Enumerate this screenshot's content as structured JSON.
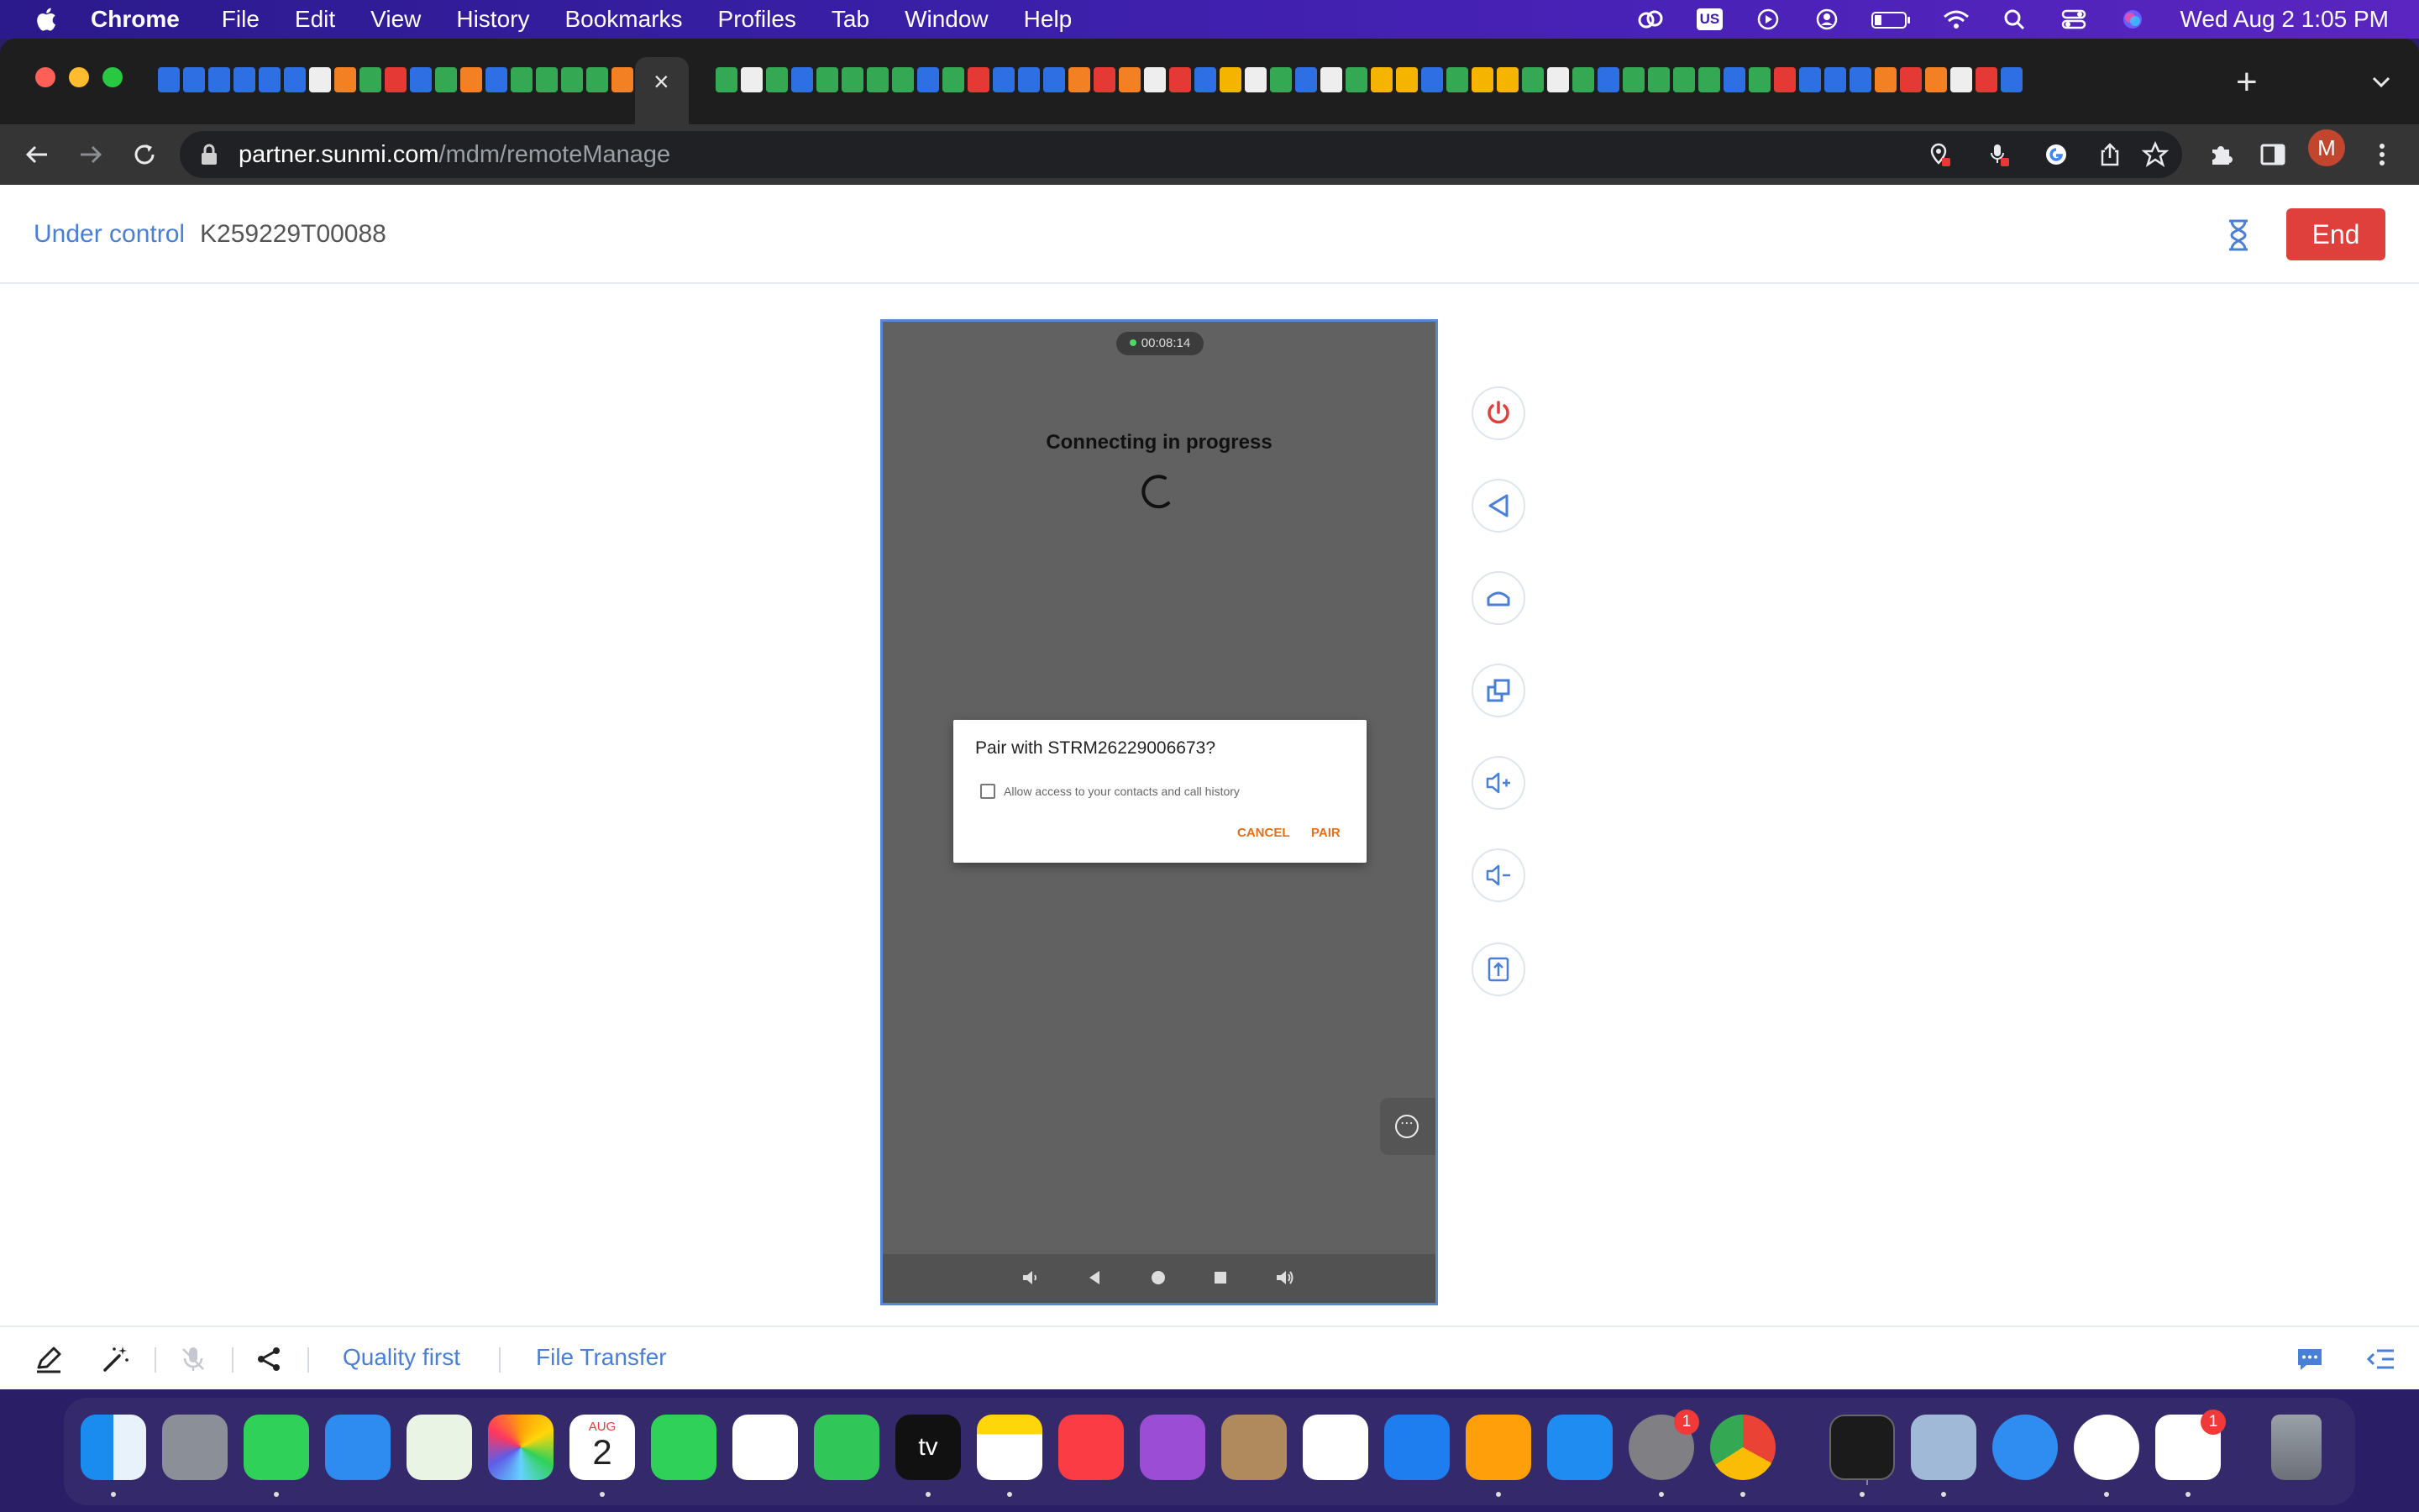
{
  "menubar": {
    "app_name": "Chrome",
    "items": [
      "File",
      "Edit",
      "View",
      "History",
      "Bookmarks",
      "Profiles",
      "Tab",
      "Window",
      "Help"
    ],
    "input_source": "US",
    "clock": "Wed Aug 2  1:05 PM"
  },
  "browser": {
    "url_host": "partner.sunmi.com",
    "url_path": "/mdm/remoteManage",
    "profile_initial": "M",
    "tab_close": "×",
    "new_tab": "+"
  },
  "header": {
    "status_label": "Under control",
    "device_id": "K259229T00088",
    "end_label": "End"
  },
  "device": {
    "session_timer": "00:08:14",
    "status_text": "Connecting in progress",
    "dialog": {
      "title": "Pair with STRM26229006673?",
      "checkbox_label": "Allow access to your contacts and call history",
      "cancel_label": "CANCEL",
      "pair_label": "PAIR"
    },
    "more_glyph": "⋯"
  },
  "bottom_toolbar": {
    "quality_label": "Quality first",
    "file_transfer_label": "File Transfer"
  },
  "dock": {
    "calendar_month": "AUG",
    "calendar_day": "2",
    "tv_label": "tv",
    "settings_badge": "1",
    "slack_badge": "1"
  },
  "colors": {
    "accent": "#4a7fd6",
    "end_button": "#e0403b",
    "dialog_action": "#e0701a",
    "device_border": "#5b86d8"
  }
}
